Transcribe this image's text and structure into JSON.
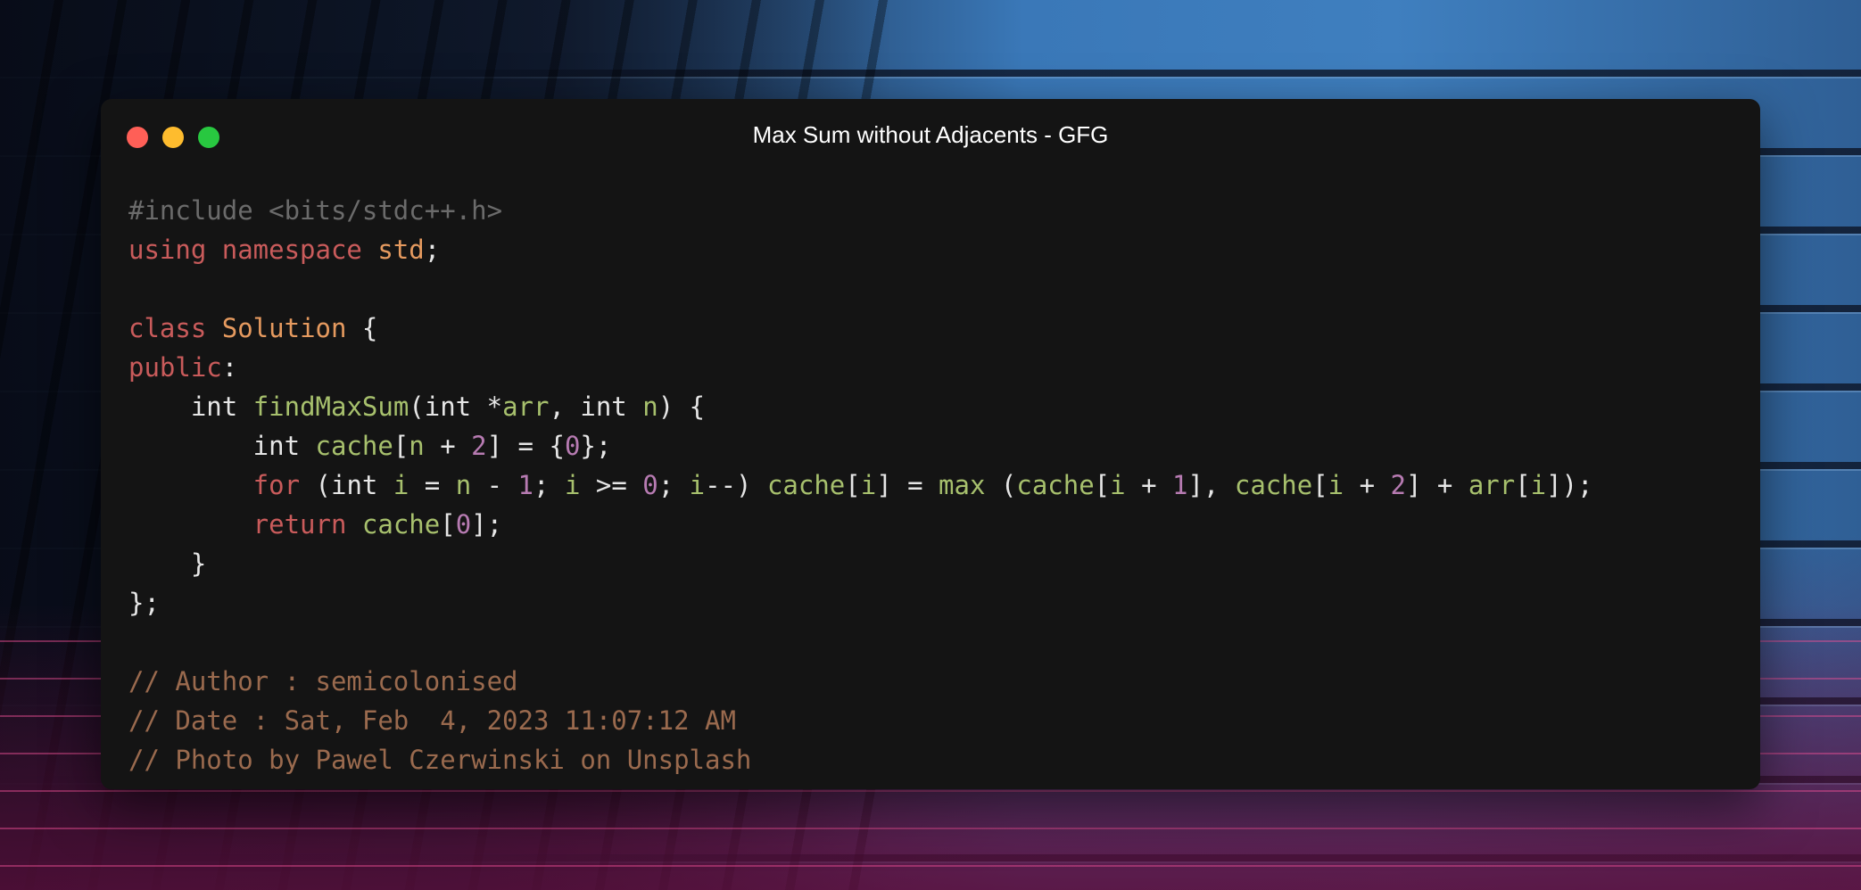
{
  "window": {
    "title": "Max Sum without Adjacents - GFG",
    "buttons": [
      {
        "name": "close",
        "color": "#ff5f57"
      },
      {
        "name": "minimize",
        "color": "#febc2e"
      },
      {
        "name": "zoom",
        "color": "#28c840"
      }
    ]
  },
  "theme": {
    "background": "#141414",
    "preprocessor": "#6b6b6b",
    "keyword": "#c95b5b",
    "type": "#e59a5f",
    "function": "#a7c06d",
    "number": "#b77bb2",
    "comment": "#9a6a4e",
    "plain": "#e6e6e6"
  },
  "code_lines": [
    [
      {
        "t": "#include <bits/stdc++.h>",
        "c": "pre"
      }
    ],
    [
      {
        "t": "using namespace ",
        "c": "kw"
      },
      {
        "t": "std",
        "c": "type"
      },
      {
        "t": ";",
        "c": "plain"
      }
    ],
    [],
    [
      {
        "t": "class ",
        "c": "kw"
      },
      {
        "t": "Solution",
        "c": "type"
      },
      {
        "t": " {",
        "c": "plain"
      }
    ],
    [
      {
        "t": "public",
        "c": "kw"
      },
      {
        "t": ":",
        "c": "plain"
      }
    ],
    [
      {
        "t": "    int ",
        "c": "plain"
      },
      {
        "t": "findMaxSum",
        "c": "fn"
      },
      {
        "t": "(int *",
        "c": "plain"
      },
      {
        "t": "arr",
        "c": "fn"
      },
      {
        "t": ", int ",
        "c": "plain"
      },
      {
        "t": "n",
        "c": "fn"
      },
      {
        "t": ") {",
        "c": "plain"
      }
    ],
    [
      {
        "t": "        int ",
        "c": "plain"
      },
      {
        "t": "cache",
        "c": "fn"
      },
      {
        "t": "[",
        "c": "plain"
      },
      {
        "t": "n",
        "c": "fn"
      },
      {
        "t": " + ",
        "c": "plain"
      },
      {
        "t": "2",
        "c": "num"
      },
      {
        "t": "] = {",
        "c": "plain"
      },
      {
        "t": "0",
        "c": "num"
      },
      {
        "t": "};",
        "c": "plain"
      }
    ],
    [
      {
        "t": "        for",
        "c": "kw"
      },
      {
        "t": " (int ",
        "c": "plain"
      },
      {
        "t": "i",
        "c": "fn"
      },
      {
        "t": " = ",
        "c": "plain"
      },
      {
        "t": "n",
        "c": "fn"
      },
      {
        "t": " - ",
        "c": "plain"
      },
      {
        "t": "1",
        "c": "num"
      },
      {
        "t": "; ",
        "c": "plain"
      },
      {
        "t": "i",
        "c": "fn"
      },
      {
        "t": " >= ",
        "c": "plain"
      },
      {
        "t": "0",
        "c": "num"
      },
      {
        "t": "; ",
        "c": "plain"
      },
      {
        "t": "i",
        "c": "fn"
      },
      {
        "t": "--) ",
        "c": "plain"
      },
      {
        "t": "cache",
        "c": "fn"
      },
      {
        "t": "[",
        "c": "plain"
      },
      {
        "t": "i",
        "c": "fn"
      },
      {
        "t": "] = ",
        "c": "plain"
      },
      {
        "t": "max",
        "c": "fn"
      },
      {
        "t": " (",
        "c": "plain"
      },
      {
        "t": "cache",
        "c": "fn"
      },
      {
        "t": "[",
        "c": "plain"
      },
      {
        "t": "i",
        "c": "fn"
      },
      {
        "t": " + ",
        "c": "plain"
      },
      {
        "t": "1",
        "c": "num"
      },
      {
        "t": "], ",
        "c": "plain"
      },
      {
        "t": "cache",
        "c": "fn"
      },
      {
        "t": "[",
        "c": "plain"
      },
      {
        "t": "i",
        "c": "fn"
      },
      {
        "t": " + ",
        "c": "plain"
      },
      {
        "t": "2",
        "c": "num"
      },
      {
        "t": "] + ",
        "c": "plain"
      },
      {
        "t": "arr",
        "c": "fn"
      },
      {
        "t": "[",
        "c": "plain"
      },
      {
        "t": "i",
        "c": "fn"
      },
      {
        "t": "]);",
        "c": "plain"
      }
    ],
    [
      {
        "t": "        return",
        "c": "kw"
      },
      {
        "t": " ",
        "c": "plain"
      },
      {
        "t": "cache",
        "c": "fn"
      },
      {
        "t": "[",
        "c": "plain"
      },
      {
        "t": "0",
        "c": "num"
      },
      {
        "t": "];",
        "c": "plain"
      }
    ],
    [
      {
        "t": "    }",
        "c": "plain"
      }
    ],
    [
      {
        "t": "};",
        "c": "plain"
      }
    ],
    [],
    [
      {
        "t": "// Author : semicolonised",
        "c": "cm"
      }
    ],
    [
      {
        "t": "// Date : Sat, Feb  4, 2023 11:07:12 AM",
        "c": "cm"
      }
    ],
    [
      {
        "t": "// Photo by Pawel Czerwinski on Unsplash",
        "c": "cm"
      }
    ]
  ]
}
